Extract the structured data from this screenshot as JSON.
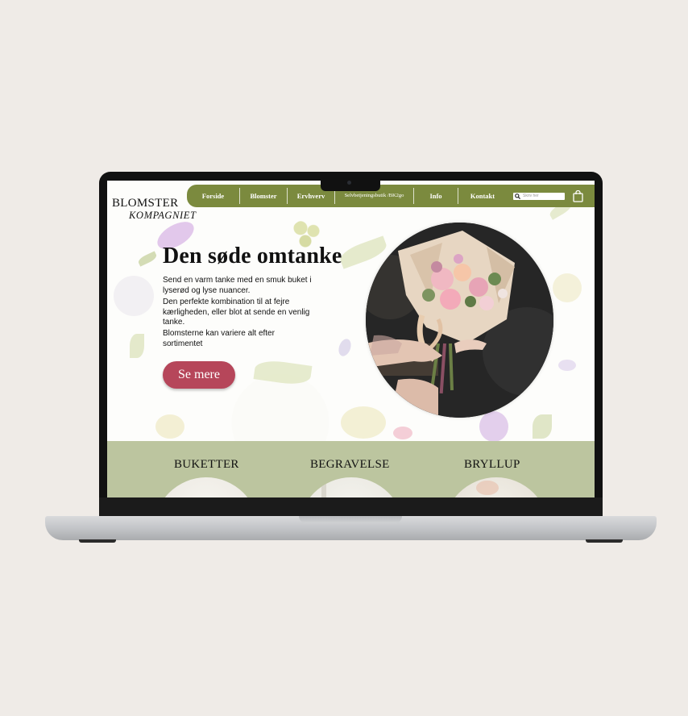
{
  "logo": {
    "top": "BLOMSTER",
    "bottom": "KOMPAGNIET"
  },
  "nav": {
    "items": [
      {
        "label": "Forside"
      },
      {
        "label": "Blomster"
      },
      {
        "label": "Ervhverv"
      },
      {
        "label": "Selvbetjeningsbutik /BK2go"
      },
      {
        "label": "Info"
      },
      {
        "label": "Kontakt"
      }
    ],
    "search_placeholder": "Skriv her",
    "accent_color": "#7b8a3e"
  },
  "hero": {
    "title": "Den søde omtanke",
    "paragraphs": [
      "Send en varm tanke med en smuk buket i lyserød og lyse nuancer.",
      "Den perfekte kombination til at fejre kærligheden, eller blot at sende en venlig tanke.",
      "Blomsterne kan variere alt efter sortimentet"
    ],
    "cta_label": "Se mere",
    "cta_color": "#b6465a"
  },
  "categories": [
    {
      "title": "BUKETTER"
    },
    {
      "title": "BEGRAVELSE"
    },
    {
      "title": "BRYLLUP"
    }
  ],
  "band_color": "#bcc59f",
  "icons": [
    "search-icon",
    "shopping-bag-icon"
  ]
}
